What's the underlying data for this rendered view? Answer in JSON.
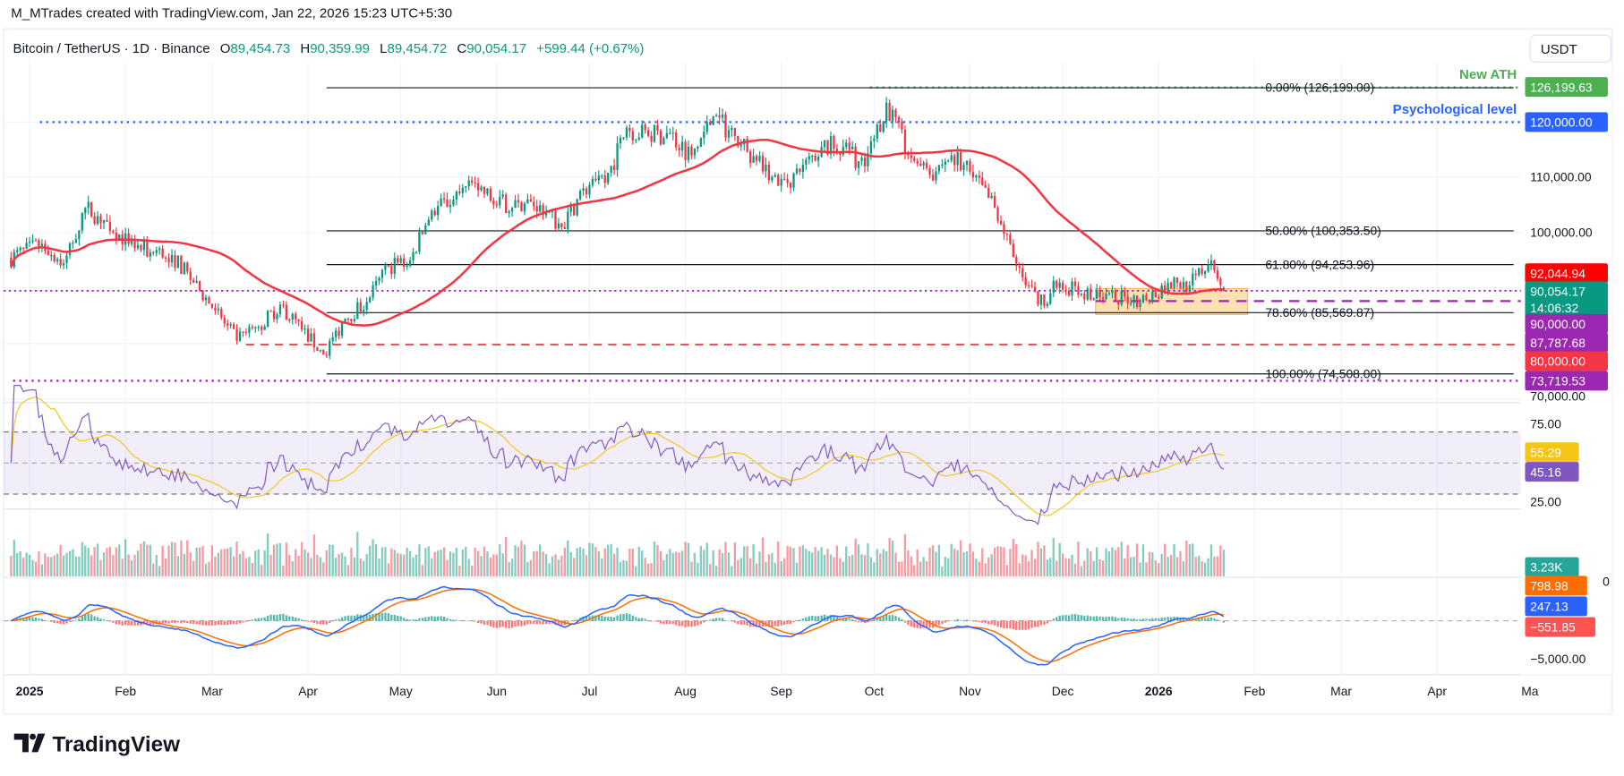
{
  "header": {
    "attribution": "M_MTrades created with TradingView.com, Jan 22, 2026 15:23 UTC+5:30"
  },
  "legend": {
    "symbol": "Bitcoin / TetherUS · 1D · Binance",
    "open_label": "O",
    "open": "89,454.73",
    "high_label": "H",
    "high": "90,359.99",
    "low_label": "L",
    "low": "89,454.72",
    "close_label": "C",
    "close": "90,054.17",
    "change": "+599.44 (+0.67%)"
  },
  "currency_button": "USDT",
  "logo_text": "TradingView",
  "colors": {
    "up": "#089981",
    "down": "#f23645",
    "ma": "#f23645",
    "rsi": "#7e57c2",
    "rsi_ma": "#f5c518",
    "macd": "#2962ff",
    "signal": "#ff6d00",
    "ath": "#4caf50",
    "psych": "#2962ff",
    "support": "#9c27b0",
    "zone": "#ff9800"
  },
  "annotations": {
    "new_ath": "New ATH",
    "psychological": "Psychological level"
  },
  "fibonacci": [
    {
      "label": "0.00% (126,199.00)",
      "price": 126199
    },
    {
      "label": "50.00% (100,353.50)",
      "price": 100353.5
    },
    {
      "label": "61.80% (94,253.96)",
      "price": 94253.96
    },
    {
      "label": "78.60% (85,569.87)",
      "price": 85569.87
    },
    {
      "label": "100.00% (74,508.00)",
      "price": 74508
    }
  ],
  "price_axis": {
    "ticks": [
      "110,000.00",
      "100,000.00",
      "70,000.00"
    ],
    "tags": [
      {
        "text": "126,199.63",
        "color": "#4caf50"
      },
      {
        "text": "120,000.00",
        "color": "#2962ff"
      },
      {
        "text": "92,044.94",
        "color": "#ff0000"
      },
      {
        "text": "90,054.17",
        "sub": "14:06:32",
        "color": "#089981"
      },
      {
        "text": "90,000.00",
        "color": "#9c27b0"
      },
      {
        "text": "87,787.68",
        "color": "#9c27b0"
      },
      {
        "text": "80,000.00",
        "color": "#f23645"
      },
      {
        "text": "73,719.53",
        "color": "#9c27b0"
      }
    ]
  },
  "rsi_axis": {
    "ticks": [
      "75.00",
      "25.00"
    ],
    "tags": [
      {
        "text": "55.29",
        "color": "#f5c518"
      },
      {
        "text": "45.16",
        "color": "#7e57c2"
      }
    ]
  },
  "volume_axis": {
    "tags": [
      {
        "text": "3.23K",
        "color": "#26a69a"
      }
    ]
  },
  "macd_axis": {
    "ticks": [
      "0",
      "−5,000.00"
    ],
    "tags": [
      {
        "text": "798.98",
        "color": "#ff6d00"
      },
      {
        "text": "247.13",
        "color": "#2962ff"
      },
      {
        "text": "−551.85",
        "color": "#ff5252"
      }
    ]
  },
  "time_axis": [
    "2025",
    "Feb",
    "Mar",
    "Apr",
    "May",
    "Jun",
    "Jul",
    "Aug",
    "Sep",
    "Oct",
    "Nov",
    "Dec",
    "2026",
    "Feb",
    "Mar",
    "Apr",
    "Ma"
  ],
  "chart_data": {
    "type": "candlestick",
    "interval": "1D",
    "ylim": [
      70000,
      128000
    ],
    "grid": true,
    "moving_average": {
      "type": "SMA",
      "last": 92044.94
    },
    "last_candle": {
      "date": "2026-01-22",
      "open": 89454.73,
      "high": 90359.99,
      "low": 89454.72,
      "close": 90054.17
    },
    "horizontal_levels": [
      {
        "price": 126199.63,
        "label": "New ATH",
        "style": "dotted"
      },
      {
        "price": 120000,
        "label": "Psychological level",
        "style": "dotted"
      },
      {
        "price": 90000,
        "style": "dotted"
      },
      {
        "price": 87787.68,
        "style": "dashed"
      },
      {
        "price": 80000,
        "style": "dashed"
      },
      {
        "price": 73719.53,
        "style": "dotted"
      }
    ],
    "consolidation_zone": {
      "from": "2025-12-12",
      "to": "2026-01-31",
      "top": 90000,
      "bottom": 85569.87
    },
    "closes": [
      [
        "2024-12-26",
        95500
      ],
      [
        "2025-01-05",
        98000
      ],
      [
        "2025-01-12",
        94500
      ],
      [
        "2025-01-19",
        104500
      ],
      [
        "2025-01-26",
        102000
      ],
      [
        "2025-02-02",
        98000
      ],
      [
        "2025-02-09",
        96500
      ],
      [
        "2025-02-16",
        96000
      ],
      [
        "2025-02-23",
        91000
      ],
      [
        "2025-03-02",
        86000
      ],
      [
        "2025-03-09",
        80500
      ],
      [
        "2025-03-16",
        83000
      ],
      [
        "2025-03-23",
        87000
      ],
      [
        "2025-03-30",
        82500
      ],
      [
        "2025-04-06",
        78000
      ],
      [
        "2025-04-13",
        84500
      ],
      [
        "2025-04-20",
        87500
      ],
      [
        "2025-04-27",
        94000
      ],
      [
        "2025-05-04",
        95000
      ],
      [
        "2025-05-11",
        104000
      ],
      [
        "2025-05-18",
        106000
      ],
      [
        "2025-05-25",
        109000
      ],
      [
        "2025-06-01",
        105000
      ],
      [
        "2025-06-08",
        105500
      ],
      [
        "2025-06-15",
        105000
      ],
      [
        "2025-06-22",
        101000
      ],
      [
        "2025-06-29",
        108000
      ],
      [
        "2025-07-06",
        109000
      ],
      [
        "2025-07-13",
        119000
      ],
      [
        "2025-07-20",
        117500
      ],
      [
        "2025-07-27",
        118000
      ],
      [
        "2025-08-03",
        114000
      ],
      [
        "2025-08-10",
        121000
      ],
      [
        "2025-08-17",
        117500
      ],
      [
        "2025-08-24",
        113000
      ],
      [
        "2025-08-31",
        108500
      ],
      [
        "2025-09-07",
        111000
      ],
      [
        "2025-09-14",
        115500
      ],
      [
        "2025-09-21",
        115500
      ],
      [
        "2025-09-28",
        112000
      ],
      [
        "2025-10-05",
        123500
      ],
      [
        "2025-10-12",
        114000
      ],
      [
        "2025-10-19",
        110500
      ],
      [
        "2025-10-26",
        114000
      ],
      [
        "2025-11-02",
        110000
      ],
      [
        "2025-11-09",
        104500
      ],
      [
        "2025-11-16",
        94000
      ],
      [
        "2025-11-23",
        87000
      ],
      [
        "2025-11-30",
        91000
      ],
      [
        "2025-12-07",
        89000
      ],
      [
        "2025-12-14",
        88000
      ],
      [
        "2025-12-21",
        88500
      ],
      [
        "2025-12-28",
        87800
      ],
      [
        "2026-01-04",
        91000
      ],
      [
        "2026-01-11",
        90500
      ],
      [
        "2026-01-18",
        95000
      ],
      [
        "2026-01-22",
        90054.17
      ]
    ],
    "indicators": {
      "rsi": {
        "last": 45.16,
        "ma_last": 55.29,
        "bands": [
          70,
          50,
          30
        ]
      },
      "volume": {
        "last": "3.23K"
      },
      "macd": {
        "macd": 247.13,
        "signal": 798.98,
        "histogram": -551.85
      }
    }
  }
}
